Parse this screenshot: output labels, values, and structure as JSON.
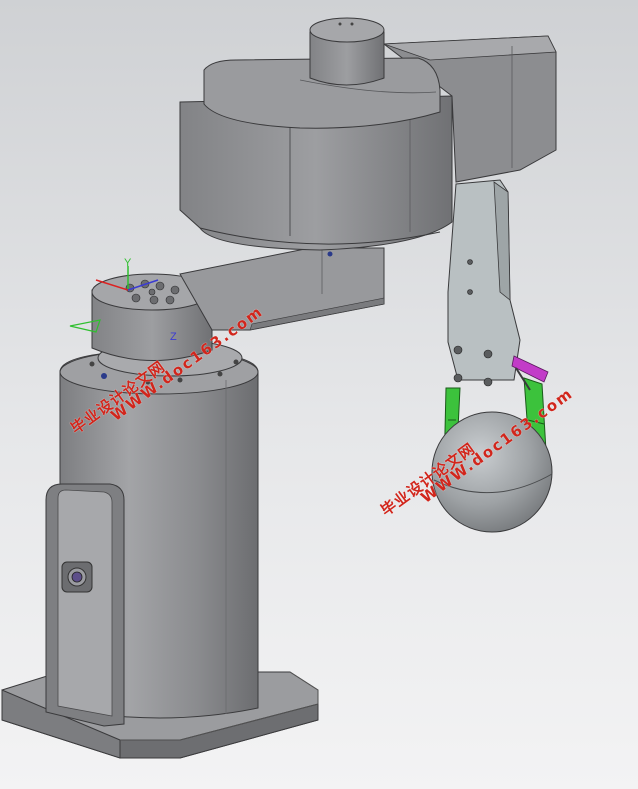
{
  "watermarks": [
    {
      "cn": "毕业设计论文网",
      "url": "WWW.doc163.com"
    },
    {
      "cn": "毕业设计论文网",
      "url": "WWW.doc163.com"
    }
  ],
  "triad": {
    "y_label": "Y",
    "z_label": "Z"
  },
  "colors": {
    "body": "#8e8f92",
    "body_dark": "#6f7073",
    "body_light": "#a6a7aa",
    "bracket": "#b9c0c2",
    "gripper_green": "#3cc23c",
    "link_magenta": "#c23cc8",
    "watermark": "#d1261c"
  }
}
